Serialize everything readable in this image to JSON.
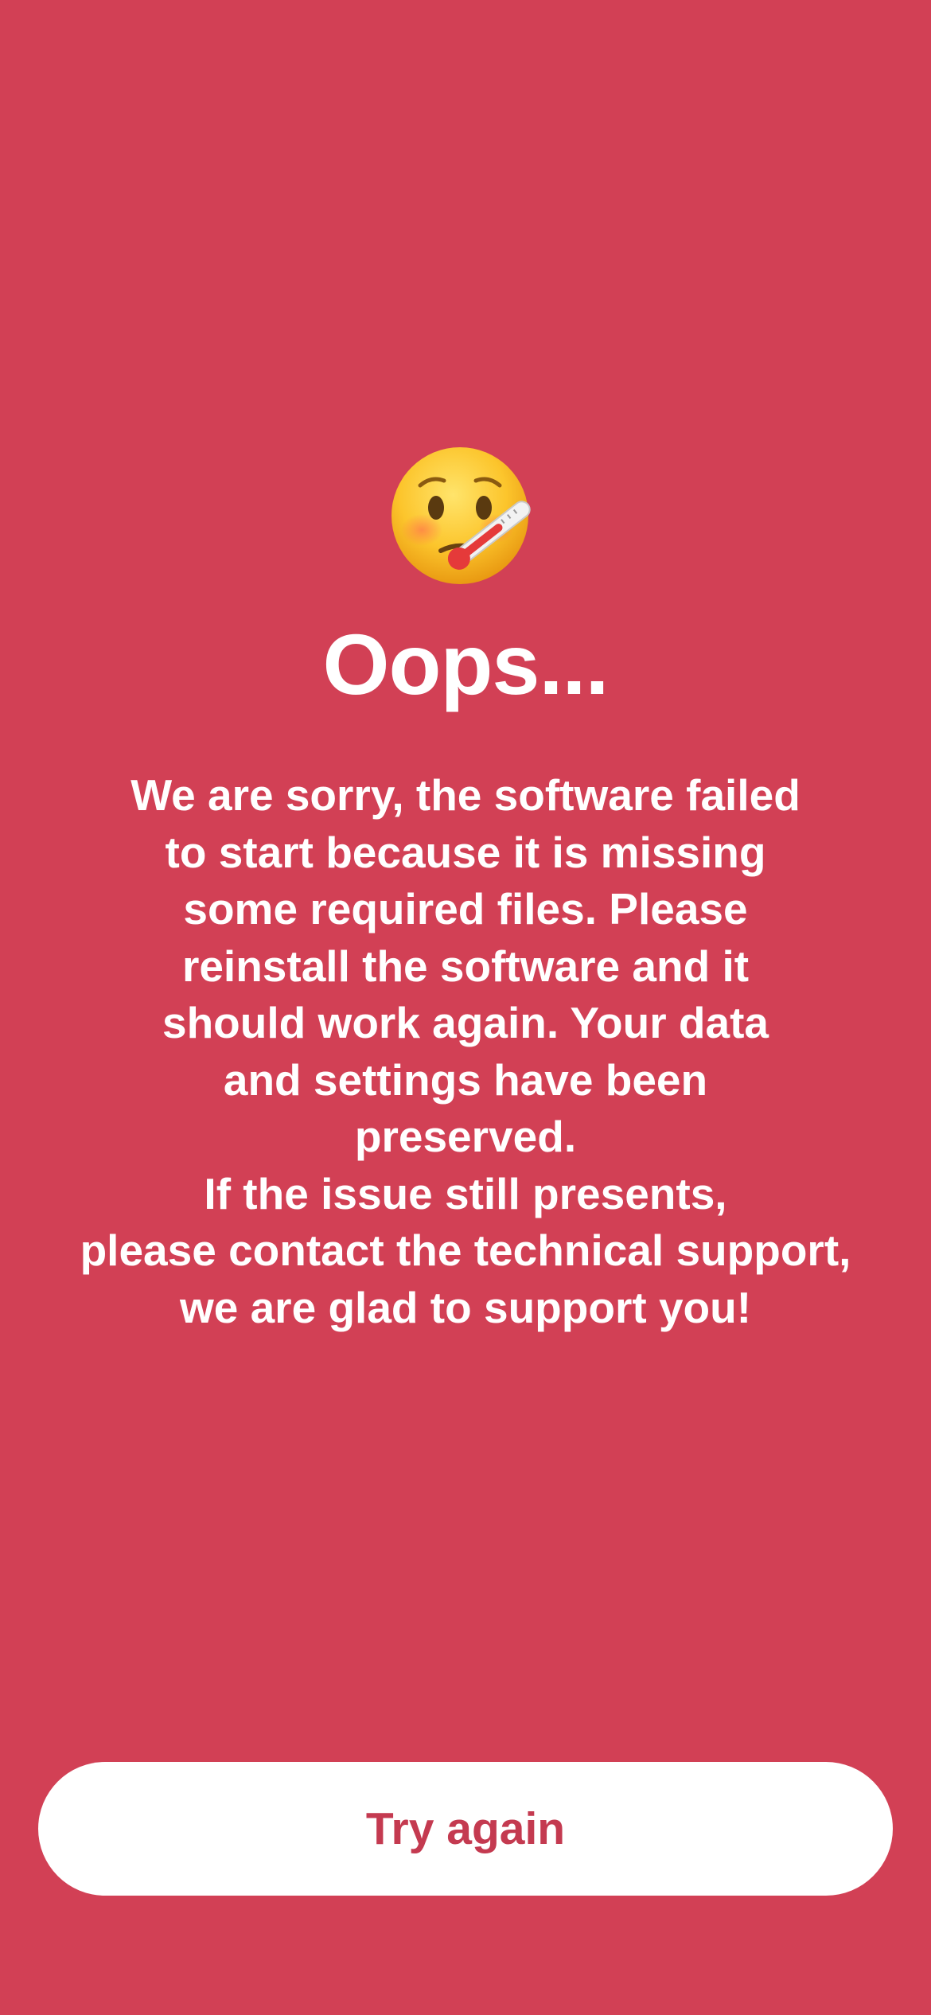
{
  "screen": {
    "background_color": "#d24055",
    "emoji_icon": "face-with-thermometer-icon",
    "title": "Oops...",
    "message_lines": [
      "We are sorry, the software failed",
      "to start because it is missing",
      "some required files. Please",
      "reinstall the software and it",
      "should work again. Your data",
      "and settings have been",
      "preserved.",
      "If the issue still presents,",
      "please contact the technical support,",
      "we are glad to support you!"
    ],
    "button": {
      "label": "Try again",
      "background_color": "#ffffff",
      "text_color": "#c43a50"
    }
  }
}
